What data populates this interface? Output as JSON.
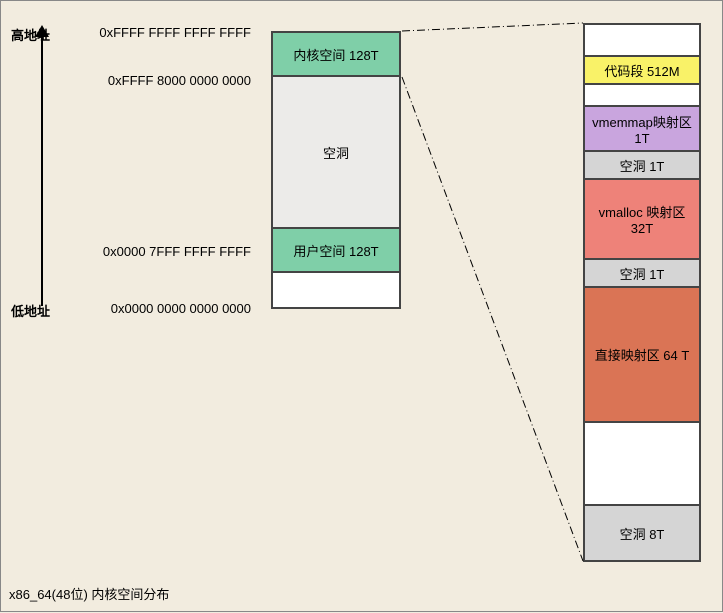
{
  "axis": {
    "high_label": "高地址",
    "low_label": "低地址"
  },
  "addresses": {
    "a1": "0xFFFF FFFF FFFF FFFF",
    "a2": "0xFFFF 8000 0000 0000",
    "a3": "0x0000 7FFF FFFF FFFF",
    "a4": "0x0000 0000 0000 0000"
  },
  "left_segments": {
    "kernel": "内核空间 128T",
    "hole": "空洞",
    "user": "用户空间 128T"
  },
  "right_segments": {
    "code": "代码段 512M",
    "vmemmap": "vmemmap映射区\n1T",
    "hole1t_a": "空洞 1T",
    "vmalloc": "vmalloc 映射区\n32T",
    "hole1t_b": "空洞 1T",
    "direct": "直接映射区 64 T",
    "hole8t": "空洞 8T"
  },
  "caption": "x86_64(48位) 内核空间分布"
}
